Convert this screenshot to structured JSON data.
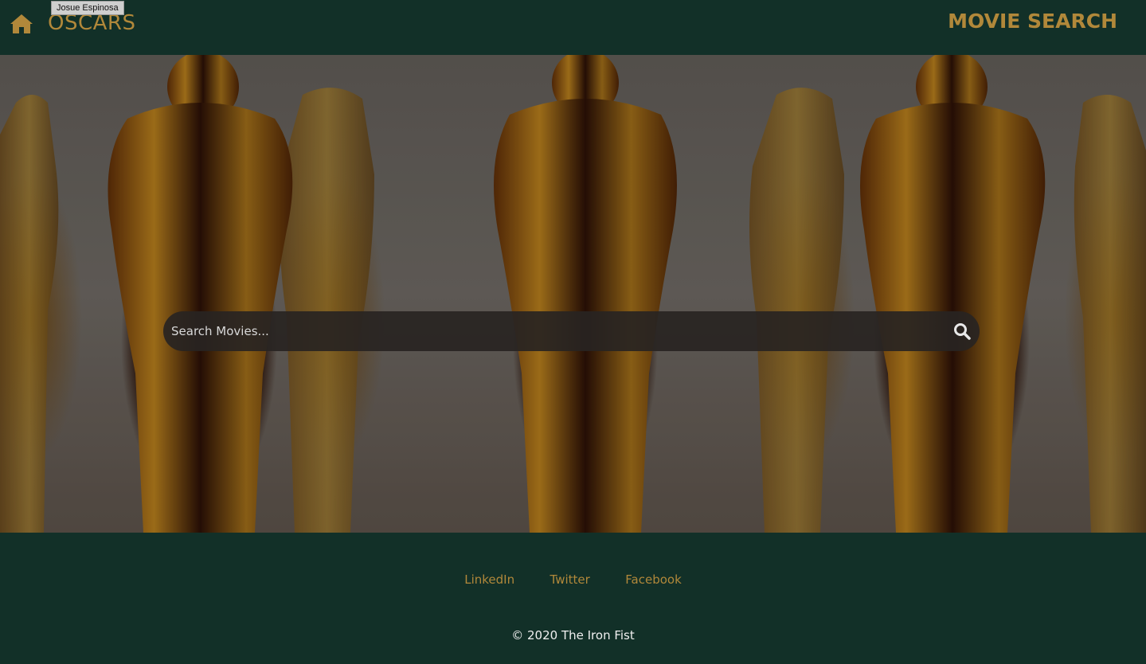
{
  "header": {
    "brand": "OSCARS",
    "tooltip": "Josue Espinosa",
    "nav_title": "MOVIE SEARCH"
  },
  "search": {
    "placeholder": "Search Movies..."
  },
  "footer": {
    "links": [
      {
        "label": "LinkedIn"
      },
      {
        "label": "Twitter"
      },
      {
        "label": "Facebook"
      }
    ],
    "copyright": "© 2020 The Iron Fist"
  },
  "colors": {
    "background": "#123028",
    "accent": "#b1883a"
  },
  "icons": {
    "home": "home-icon",
    "search": "search-icon"
  }
}
